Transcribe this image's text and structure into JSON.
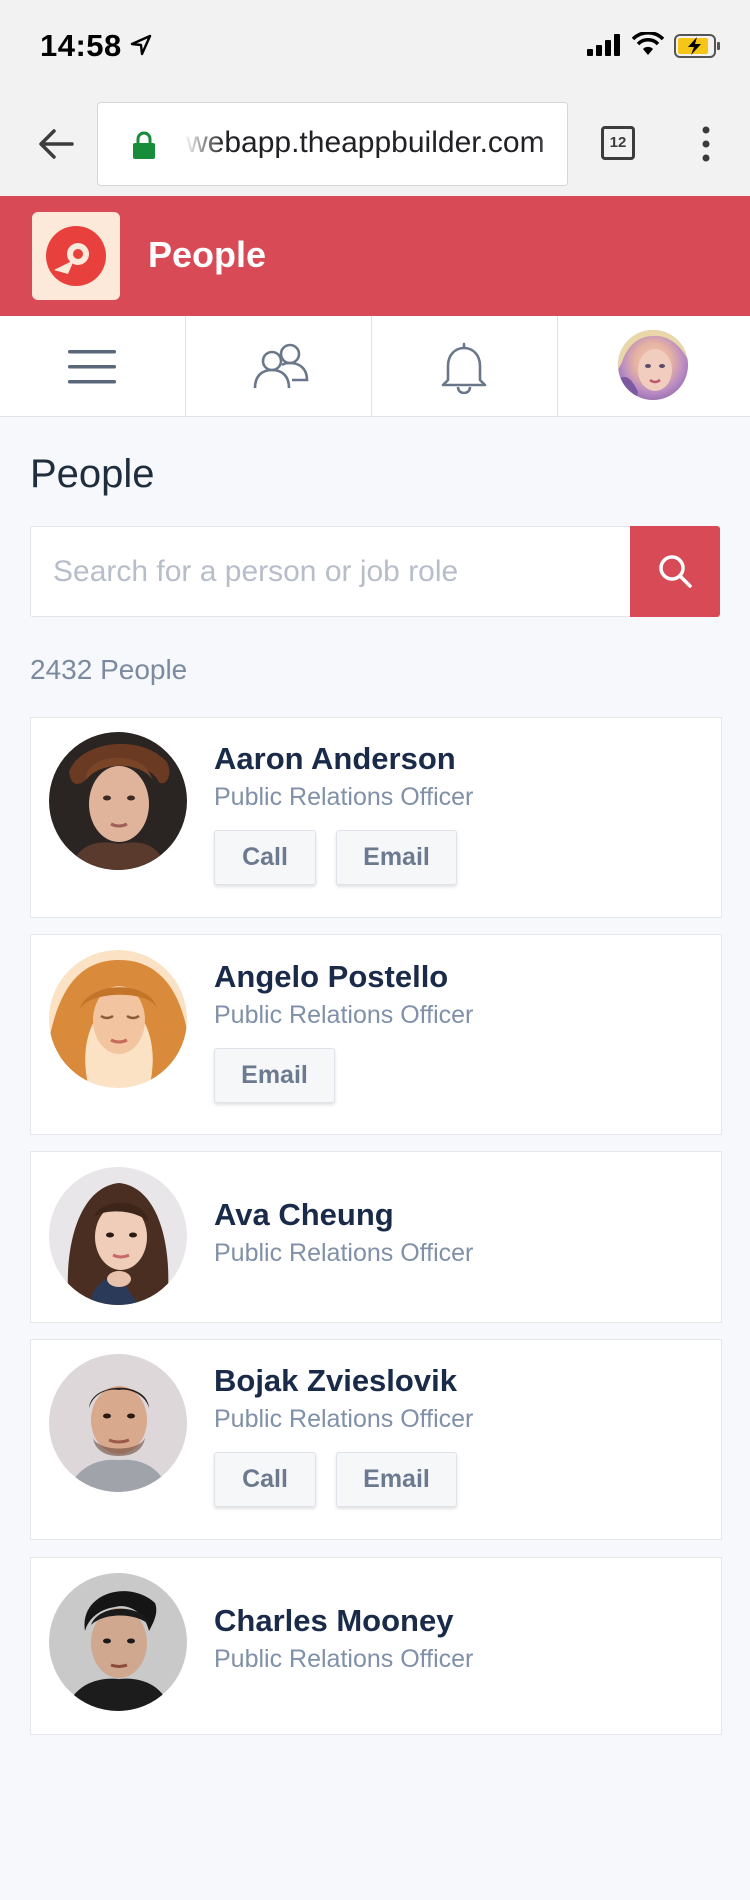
{
  "status_bar": {
    "time": "14:58"
  },
  "browser": {
    "url": "webapp.theappbuilder.com",
    "tab_count": "12"
  },
  "app_header": {
    "title": "People"
  },
  "nav": {
    "items": [
      {
        "icon": "hamburger-menu-icon"
      },
      {
        "icon": "people-icon"
      },
      {
        "icon": "bell-icon"
      },
      {
        "icon": "user-avatar"
      }
    ]
  },
  "main": {
    "heading": "People",
    "search_placeholder": "Search for a person or job role",
    "count_text": "2432 People"
  },
  "people": [
    {
      "name": "Aaron Anderson",
      "role": "Public Relations Officer",
      "call_label": "Call",
      "email_label": "Email"
    },
    {
      "name": "Angelo Postello",
      "role": "Public Relations Officer",
      "email_label": "Email"
    },
    {
      "name": "Ava Cheung",
      "role": "Public Relations Officer"
    },
    {
      "name": "Bojak Zvieslovik",
      "role": "Public Relations Officer",
      "call_label": "Call",
      "email_label": "Email"
    },
    {
      "name": "Charles Mooney",
      "role": "Public Relations Officer"
    }
  ],
  "colors": {
    "brand": "#d74a56",
    "name_text": "#1a2b4a",
    "role_text": "#8090a8"
  }
}
